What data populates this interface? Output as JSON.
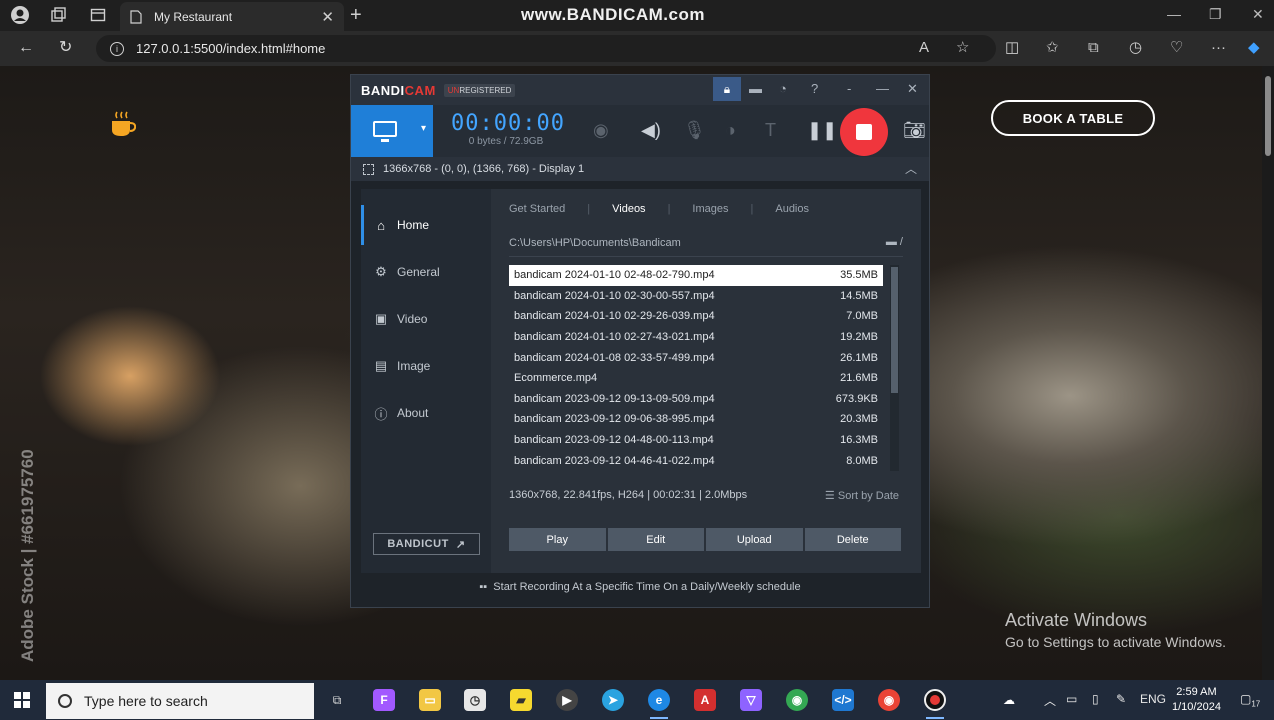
{
  "browser": {
    "tab_title": "My Restaurant",
    "url": "127.0.0.1:5500/index.html#home",
    "watermark": "www.BANDICAM.com"
  },
  "page": {
    "book_button": "BOOK A TABLE",
    "stock_watermark": "Adobe Stock | #661975760",
    "activate_title": "Activate Windows",
    "activate_sub": "Go to Settings to activate Windows."
  },
  "bandicam": {
    "logo_a": "BANDI",
    "logo_b": "CAM",
    "unreg_a": "UN",
    "unreg_b": "REGISTERED",
    "timer": "00:00:00",
    "size": "0 bytes / 72.9GB",
    "display": "1366x768 - (0, 0), (1366, 768) - Display 1",
    "sidebar": [
      "Home",
      "General",
      "Video",
      "Image",
      "About"
    ],
    "bandicut": "BANDICUT",
    "tabs": [
      "Get Started",
      "Videos",
      "Images",
      "Audios"
    ],
    "path": "C:\\Users\\HP\\Documents\\Bandicam",
    "files": [
      {
        "name": "bandicam 2024-01-10 02-48-02-790.mp4",
        "size": "35.5MB"
      },
      {
        "name": "bandicam 2024-01-10 02-30-00-557.mp4",
        "size": "14.5MB"
      },
      {
        "name": "bandicam 2024-01-10 02-29-26-039.mp4",
        "size": "7.0MB"
      },
      {
        "name": "bandicam 2024-01-10 02-27-43-021.mp4",
        "size": "19.2MB"
      },
      {
        "name": "bandicam 2024-01-08 02-33-57-499.mp4",
        "size": "26.1MB"
      },
      {
        "name": "Ecommerce.mp4",
        "size": "21.6MB"
      },
      {
        "name": "bandicam 2023-09-12 09-13-09-509.mp4",
        "size": "673.9KB"
      },
      {
        "name": "bandicam 2023-09-12 09-06-38-995.mp4",
        "size": "20.3MB"
      },
      {
        "name": "bandicam 2023-09-12 04-48-00-113.mp4",
        "size": "16.3MB"
      },
      {
        "name": "bandicam 2023-09-12 04-46-41-022.mp4",
        "size": "8.0MB"
      }
    ],
    "file_info": "1360x768, 22.841fps, H264 | 00:02:31 | 2.0Mbps",
    "sort": "Sort by Date",
    "buttons": [
      "Play",
      "Edit",
      "Upload",
      "Delete"
    ],
    "footer": "Start Recording At a Specific Time On a Daily/Weekly schedule"
  },
  "taskbar": {
    "search_placeholder": "Type here to search",
    "lang": "ENG",
    "time": "2:59 AM",
    "date": "1/10/2024",
    "notif_count": "17"
  },
  "colors": {
    "accent": "#1f7fd8",
    "record": "#f0363d",
    "timer": "#43a5ff"
  }
}
